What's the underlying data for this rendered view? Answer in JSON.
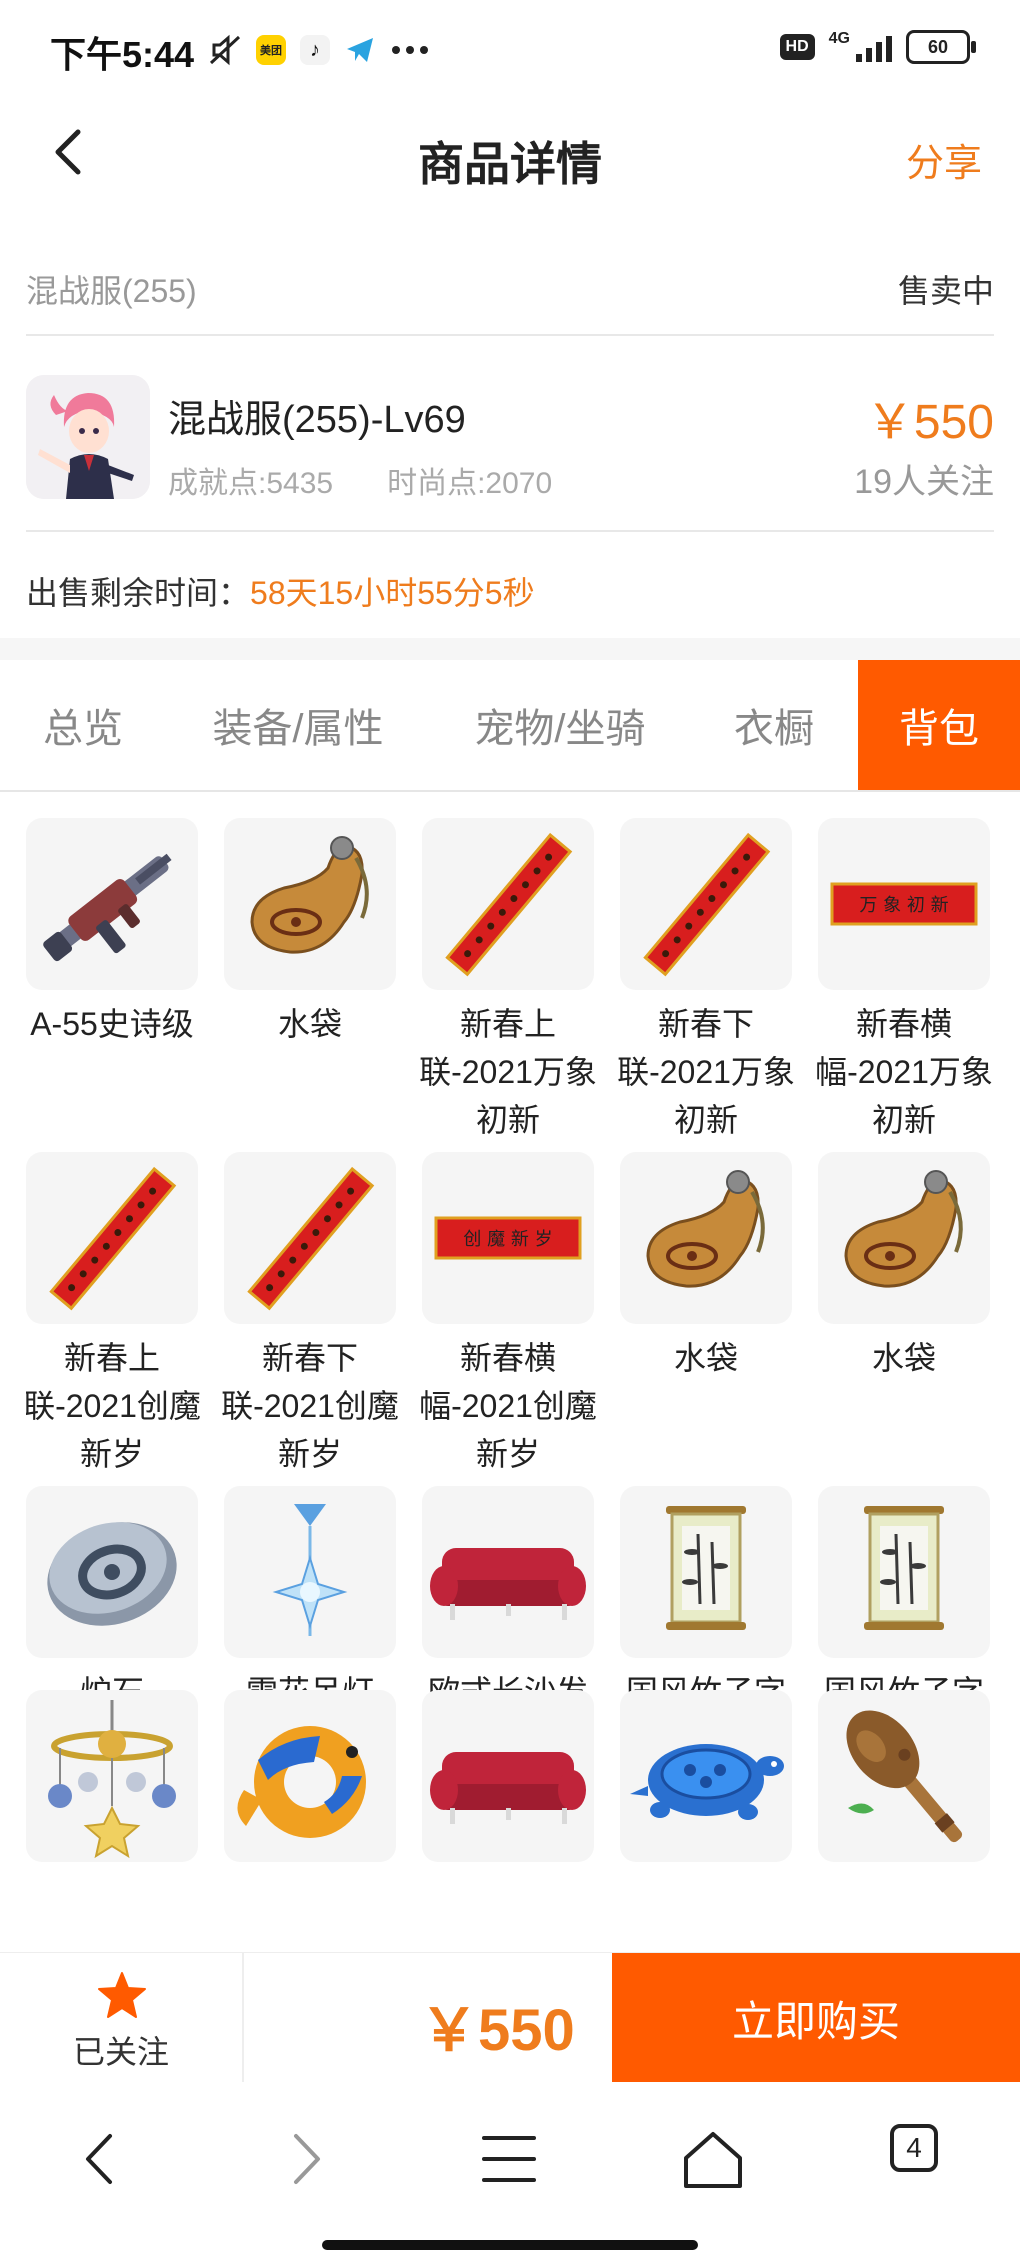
{
  "status_bar": {
    "time": "下午5:44",
    "app_icons": [
      "mute-icon",
      "meituan-icon",
      "tiktok-icon",
      "telegram-icon",
      "more-dots-icon"
    ],
    "meituan_label": "美团",
    "hd_badge": "HD",
    "network": "4G",
    "battery": "60"
  },
  "header": {
    "title": "商品详情",
    "share": "分享",
    "accent": "#ef7c1d"
  },
  "listing": {
    "server": "混战服(255)",
    "status": "售卖中",
    "title": "混战服(255)-Lv69",
    "achievement": "成就点:5435",
    "fashion": "时尚点:2070",
    "price": "￥550",
    "followers": "19人关注",
    "remaining_label": "出售剩余时间：",
    "remaining_value": "58天15小时55分5秒"
  },
  "tabs": [
    {
      "label": "总览"
    },
    {
      "label": "装备/属性"
    },
    {
      "label": "宠物/坐骑"
    },
    {
      "label": "衣橱"
    },
    {
      "label": "背包",
      "active": true
    }
  ],
  "items": [
    {
      "name": "A-55史诗级",
      "icon": "rifle"
    },
    {
      "name": "水袋",
      "icon": "waterbag"
    },
    {
      "name": "新春上联-2021万象初新",
      "icon": "couplet"
    },
    {
      "name": "新春下联-2021万象初新",
      "icon": "couplet"
    },
    {
      "name": "新春横幅-2021万象初新",
      "icon": "banner",
      "banner_text": "万 象 初 新"
    },
    {
      "name": "新春上联-2021创魔新岁",
      "icon": "couplet"
    },
    {
      "name": "新春下联-2021创魔新岁",
      "icon": "couplet"
    },
    {
      "name": "新春横幅-2021创魔新岁",
      "icon": "banner",
      "banner_text": "创 魔 新 岁"
    },
    {
      "name": "水袋",
      "icon": "waterbag"
    },
    {
      "name": "水袋",
      "icon": "waterbag"
    },
    {
      "name": "炉石",
      "icon": "hearthstone"
    },
    {
      "name": "雪花吊灯",
      "icon": "chandelier"
    },
    {
      "name": "欧式长沙发",
      "icon": "sofa"
    },
    {
      "name": "国风竹子字画",
      "icon": "scroll"
    },
    {
      "name": "国风竹子字画",
      "icon": "scroll"
    },
    {
      "name": "",
      "icon": "mobile"
    },
    {
      "name": "",
      "icon": "swim-ring"
    },
    {
      "name": "",
      "icon": "sofa"
    },
    {
      "name": "",
      "icon": "turtle"
    },
    {
      "name": "",
      "icon": "club"
    }
  ],
  "bottom_bar": {
    "follow": "已关注",
    "price": "￥550",
    "buy": "立即购买",
    "buy_color": "#ff5a00"
  },
  "browser": {
    "tab_count": "4"
  }
}
